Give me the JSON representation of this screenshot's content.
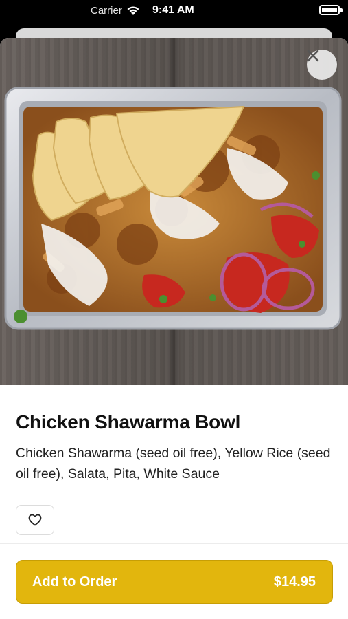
{
  "status_bar": {
    "carrier": "Carrier",
    "time": "9:41 AM"
  },
  "item": {
    "name": "Chicken Shawarma Bowl",
    "description": "Chicken Shawarma (seed oil free), Yellow Rice (seed oil free), Salata, Pita, White Sauce"
  },
  "actions": {
    "add_label": "Add to Order",
    "price": "$14.95"
  },
  "icons": {
    "close": "close-icon",
    "favorite": "heart-icon",
    "wifi": "wifi-icon",
    "battery": "battery-icon"
  },
  "colors": {
    "accent": "#e2b60d",
    "text": "#111111"
  }
}
